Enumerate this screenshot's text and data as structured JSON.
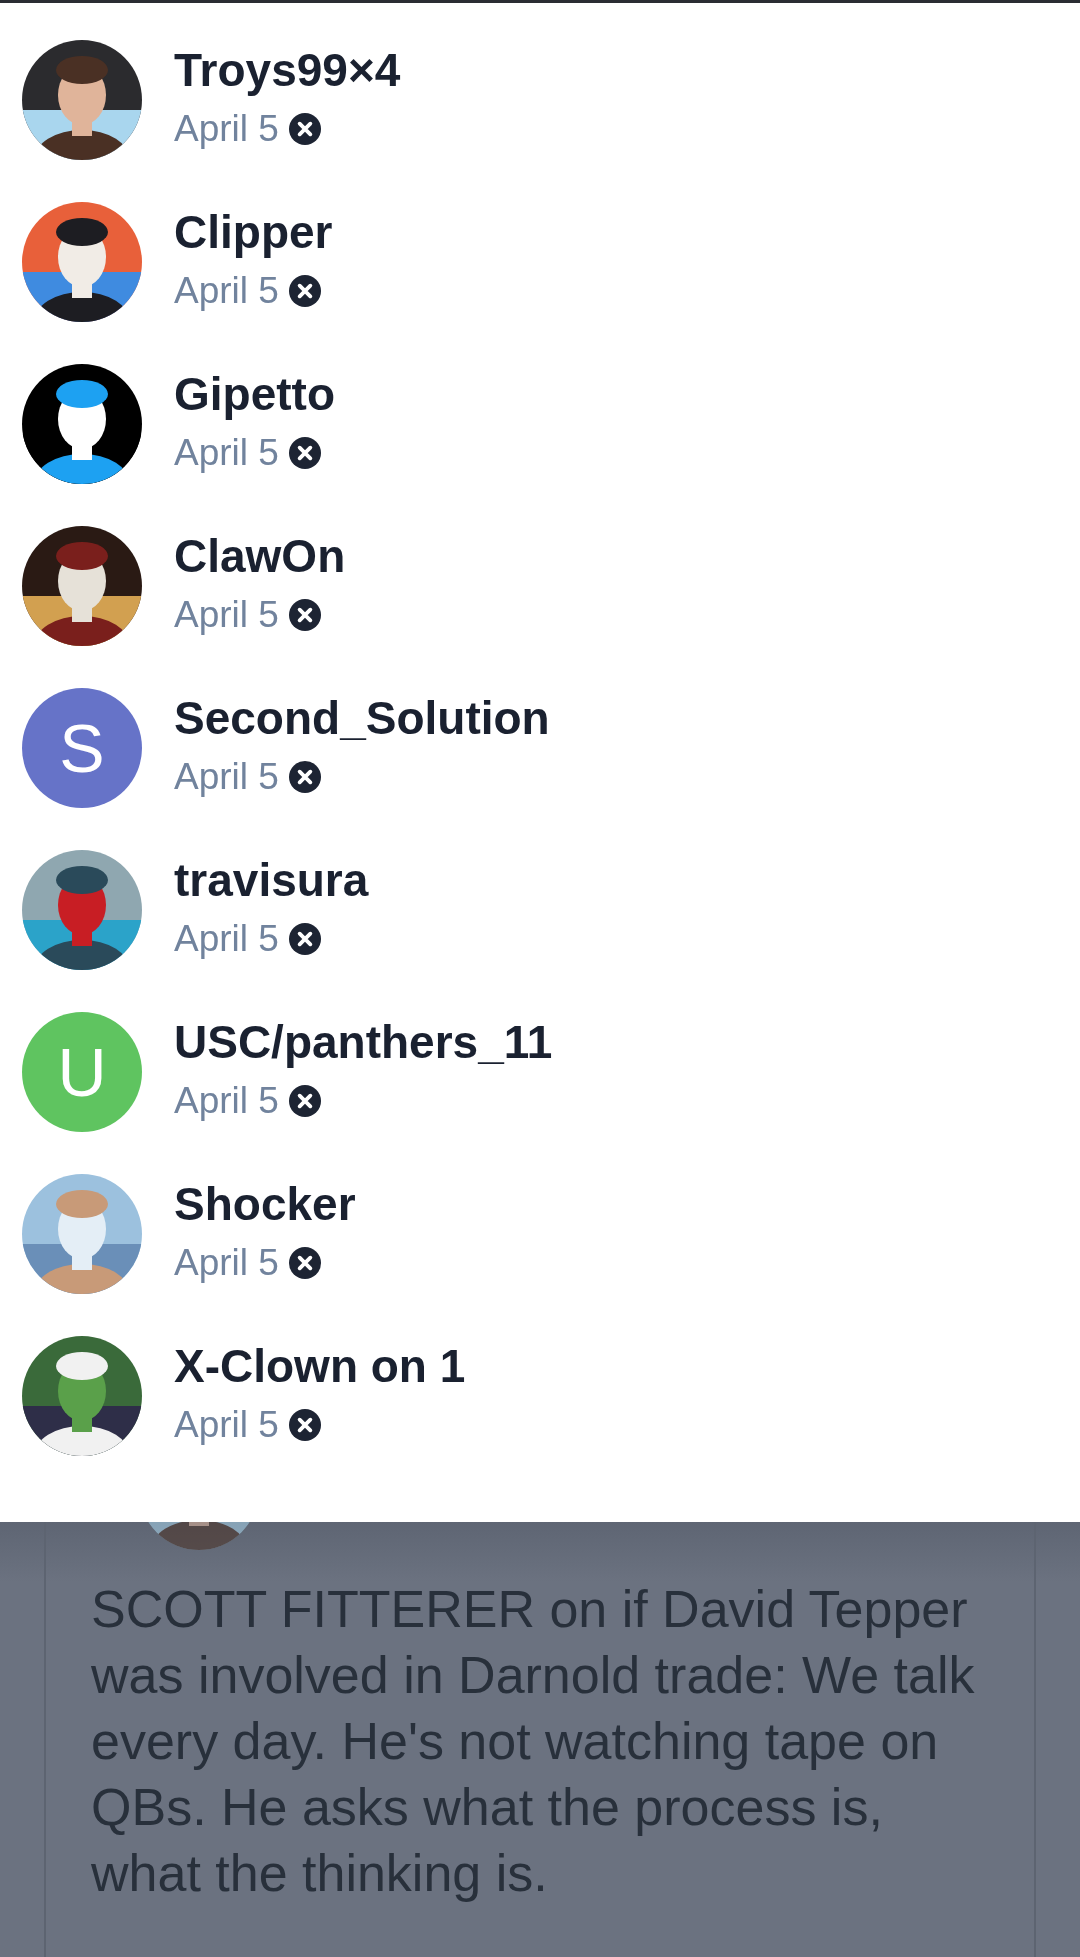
{
  "users": [
    {
      "name": "Troys99×4",
      "date": "April 5"
    },
    {
      "name": "Clipper",
      "date": "April 5"
    },
    {
      "name": "Gipetto",
      "date": "April 5"
    },
    {
      "name": "ClawOn",
      "date": "April 5"
    },
    {
      "name": "Second_Solution",
      "date": "April 5",
      "avatar": {
        "kind": "letter",
        "letter": "S",
        "color": "#6673c8"
      }
    },
    {
      "name": "travisura",
      "date": "April 5"
    },
    {
      "name": "USC/panthers_11",
      "date": "April 5",
      "avatar": {
        "kind": "letter",
        "letter": "U",
        "color": "#5fc460"
      }
    },
    {
      "name": "Shocker",
      "date": "April 5"
    },
    {
      "name": "X-Clown on 1",
      "date": "April 5"
    }
  ],
  "tweet": {
    "text": "SCOTT FITTERER on if David Tepper was involved in Darnold trade: We talk every day. He's not watching tape on QBs. He asks what the process is, what the thinking is."
  }
}
